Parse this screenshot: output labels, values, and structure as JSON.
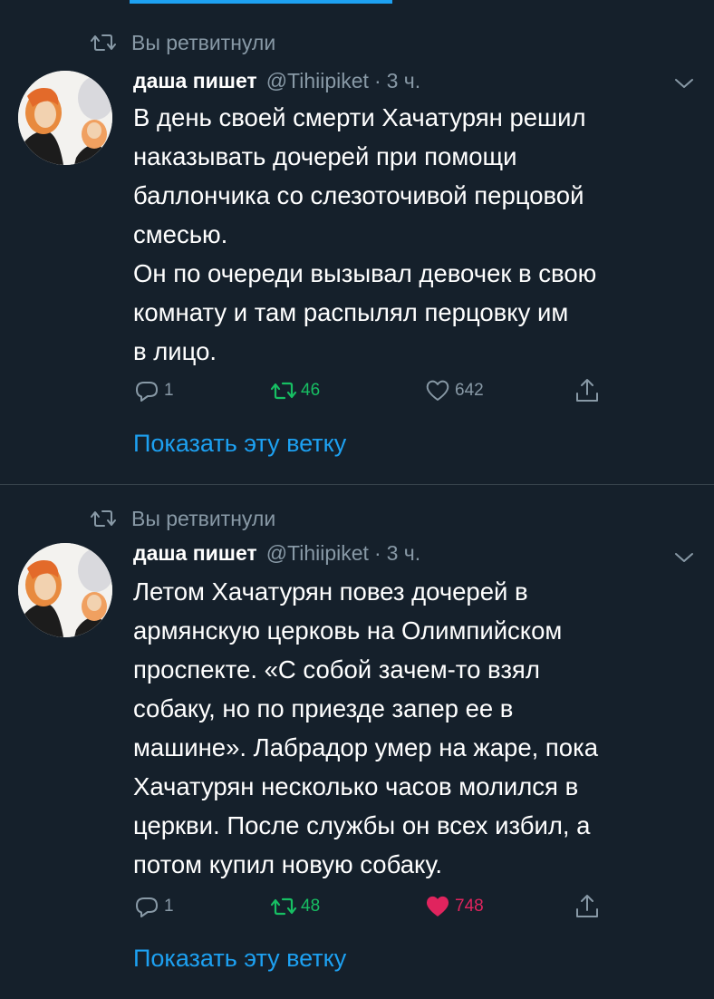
{
  "tweets": [
    {
      "retweet_label": "Вы ретвитнули",
      "author_name": "даша пишет",
      "author_handle": "@Tihiipiket",
      "dot": "·",
      "time": "3 ч.",
      "text": "В день своей смерти Хачатурян решил\nнаказывать дочерей при помощи\nбаллончика со слезоточивой перцовой\nсмесью.\nОн по очереди вызывал девочек в свою\nкомнату и там распылял перцовку им\nв лицо.",
      "reply_count": "1",
      "retweet_count": "46",
      "like_count": "642",
      "liked": false,
      "show_thread": "Показать эту ветку"
    },
    {
      "retweet_label": "Вы ретвитнули",
      "author_name": "даша пишет",
      "author_handle": "@Tihiipiket",
      "dot": "·",
      "time": "3 ч.",
      "text": "Летом Хачатурян повез дочерей в\nармянскую церковь на Олимпийском\nпроспекте. «С собой зачем-то взял\nсобаку, но по приезде запер ее в\nмашине». Лабрадор умер на жаре, пока\nХачатурян несколько часов молился в\nцеркви. После службы он всех избил, а\nпотом купил новую собаку.",
      "reply_count": "1",
      "retweet_count": "48",
      "like_count": "748",
      "liked": true,
      "show_thread": "Показать эту ветку"
    }
  ],
  "colors": {
    "background": "#15202b",
    "accent": "#1da1f2",
    "secondary_text": "#8899a6",
    "retweet_green": "#17bf63",
    "like_red": "#e0245e",
    "divider": "#38444d"
  },
  "icons": [
    "retweet-icon",
    "chevron-down-icon",
    "reply-icon",
    "like-icon",
    "share-icon",
    "avatar-illustration"
  ]
}
